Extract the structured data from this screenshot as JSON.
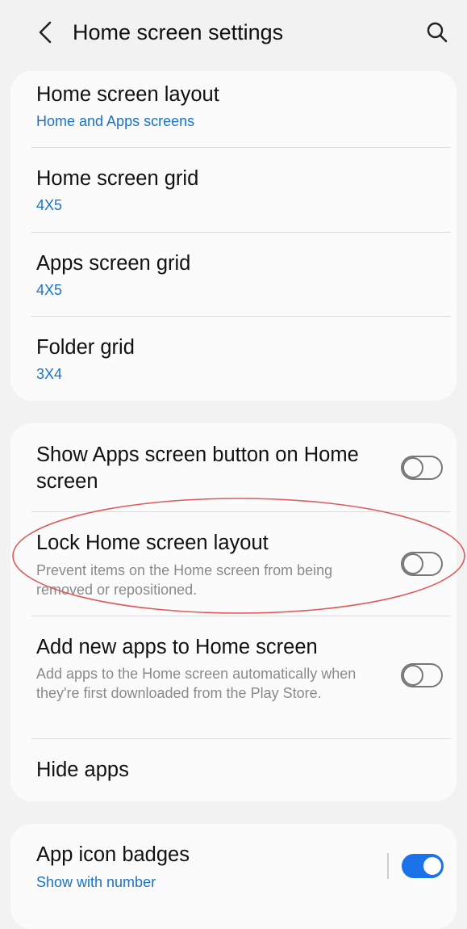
{
  "header": {
    "title": "Home screen settings",
    "back_icon": "chevron-left-icon",
    "search_icon": "search-icon"
  },
  "layout_section": {
    "items": [
      {
        "title": "Home screen layout",
        "value": "Home and Apps screens"
      },
      {
        "title": "Home screen grid",
        "value": "4X5"
      },
      {
        "title": "Apps screen grid",
        "value": "4X5"
      },
      {
        "title": "Folder grid",
        "value": "3X4"
      }
    ]
  },
  "toggle_section": {
    "items": [
      {
        "title": "Show Apps screen button on Home screen",
        "toggle": "off"
      },
      {
        "title": "Lock Home screen layout",
        "description": "Prevent items on the Home screen from being removed or repositioned.",
        "toggle": "off"
      },
      {
        "title": "Add new apps to Home screen",
        "description": "Add apps to the Home screen automatically when they're first downloaded from the Play Store.",
        "toggle": "off"
      },
      {
        "title": "Hide apps"
      }
    ]
  },
  "badges_section": {
    "title": "App icon badges",
    "value": "Show with number",
    "toggle": "on"
  },
  "colors": {
    "background": "#f2f2f2",
    "card": "#fbfbfb",
    "accent": "#1a73e8",
    "highlight": "#e05a5a"
  }
}
